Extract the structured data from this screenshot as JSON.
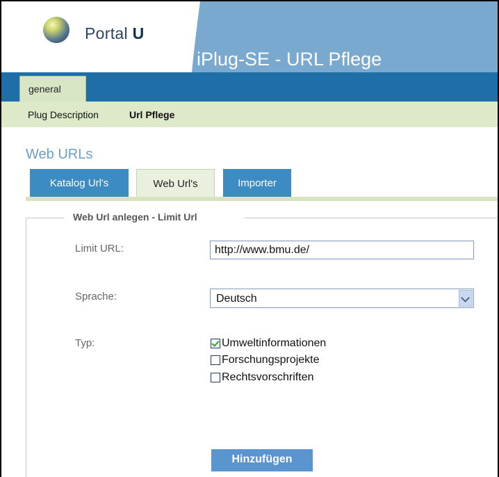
{
  "brand": {
    "name_regular": "Portal",
    "name_bold": "U"
  },
  "app_title": "iPlug-SE - URL Pflege",
  "nav": {
    "tabs": [
      {
        "label": "general",
        "active": true
      }
    ]
  },
  "sub_nav": {
    "items": [
      {
        "label": "Plug Description",
        "active": false
      },
      {
        "label": "Url Pflege",
        "active": true
      }
    ]
  },
  "section_title": "Web URLs",
  "tabs": [
    {
      "label": "Katalog Url's",
      "active": false
    },
    {
      "label": "Web Url's",
      "active": true
    },
    {
      "label": "Importer",
      "active": false
    }
  ],
  "form": {
    "legend": "Web Url anlegen - Limit Url",
    "limit_url": {
      "label": "Limit URL:",
      "value": "http://www.bmu.de/"
    },
    "sprache": {
      "label": "Sprache:",
      "selected": "Deutsch"
    },
    "typ": {
      "label": "Typ:",
      "options": [
        {
          "label": "Umweltinformationen",
          "checked": true
        },
        {
          "label": "Forschungsprojekte",
          "checked": false
        },
        {
          "label": "Rechtsvorschriften",
          "checked": false
        }
      ]
    },
    "submit_label": "Hinzufügen"
  },
  "colors": {
    "header_blue": "#7aa9cf",
    "nav_blue": "#1f6ea8",
    "tab_blue": "#3d8bc3",
    "sub_nav_green": "#dde9c8",
    "button_blue": "#5b95cf"
  },
  "icons": {
    "logo": "portalu-globe-icon",
    "dropdown": "chevron-down-icon",
    "checkbox_check": "checkmark-icon"
  }
}
